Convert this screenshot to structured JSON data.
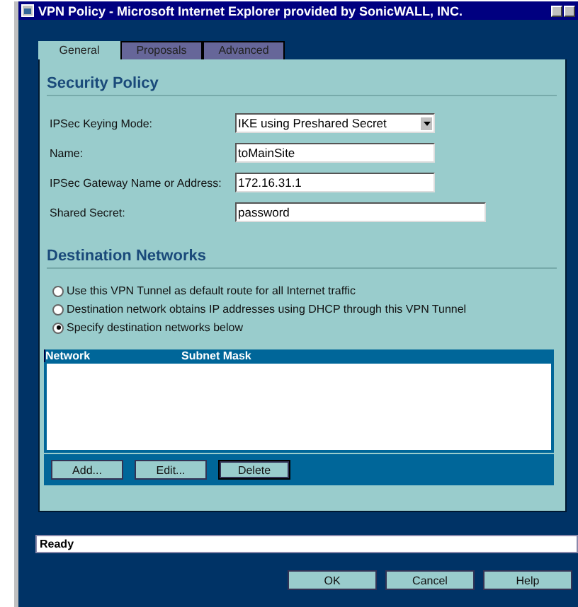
{
  "window": {
    "title": "VPN Policy - Microsoft Internet Explorer provided by SonicWALL, INC."
  },
  "tabs": [
    {
      "label": "General",
      "selected": true
    },
    {
      "label": "Proposals",
      "selected": false
    },
    {
      "label": "Advanced",
      "selected": false
    }
  ],
  "security_policy": {
    "heading": "Security Policy",
    "fields": [
      {
        "kind": "select",
        "label": "IPSec Keying Mode:",
        "value": "IKE using Preshared Secret"
      },
      {
        "kind": "text",
        "label": "Name:",
        "value": "toMainSite"
      },
      {
        "kind": "text",
        "label": "IPSec Gateway Name or Address:",
        "value": "172.16.31.1"
      },
      {
        "kind": "wide",
        "label": "Shared Secret:",
        "value": "password"
      }
    ]
  },
  "destination_networks": {
    "heading": "Destination Networks",
    "options": [
      {
        "label": "Use this VPN Tunnel as default route for all Internet traffic",
        "selected": false
      },
      {
        "label": "Destination network obtains IP addresses using DHCP through this VPN Tunnel",
        "selected": false
      },
      {
        "label": "Specify destination networks below",
        "selected": true
      }
    ],
    "table": {
      "columns": [
        "Network",
        "Subnet Mask"
      ]
    },
    "buttons": [
      "Add...",
      "Edit...",
      "Delete"
    ]
  },
  "status_bar": "Ready",
  "buttons": [
    "OK",
    "Cancel",
    "Help"
  ]
}
